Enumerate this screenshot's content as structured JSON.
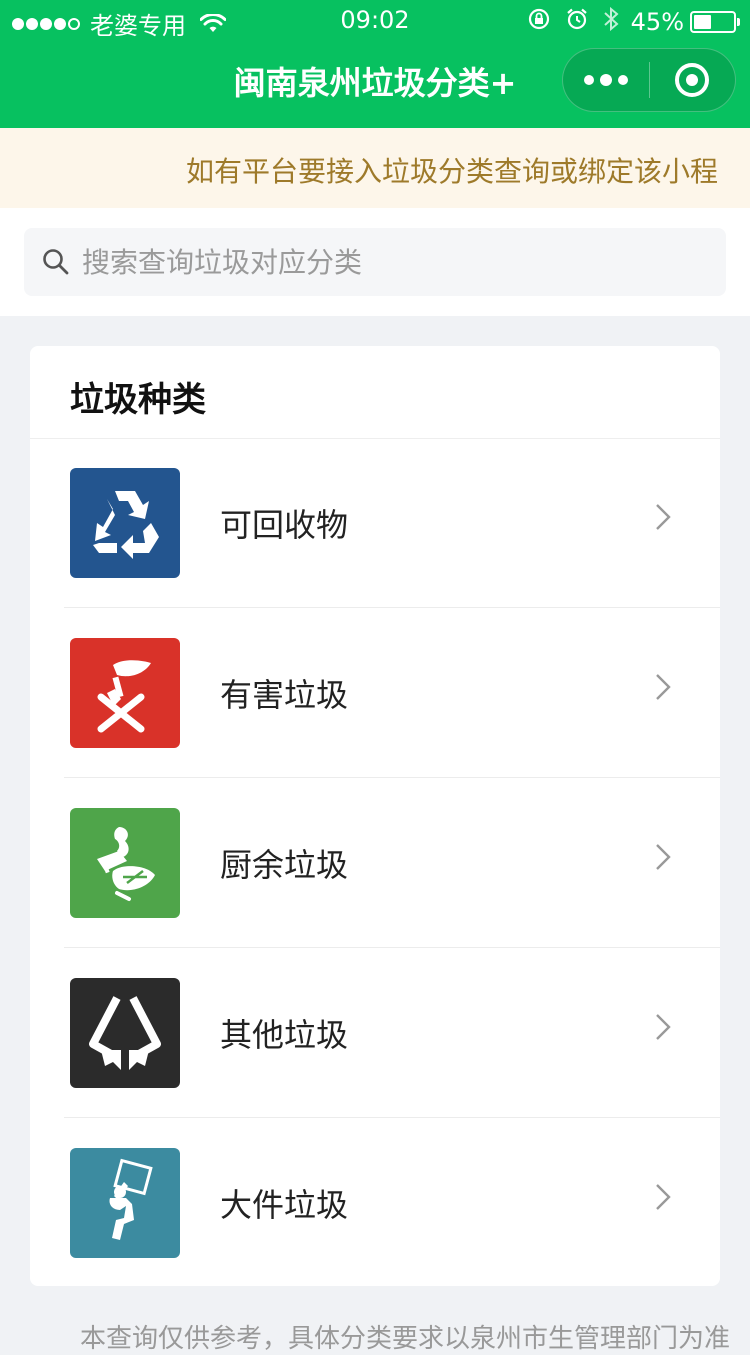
{
  "status_bar": {
    "carrier": "老婆专用",
    "time": "09:02",
    "battery_percent": "45%",
    "battery_level": 0.45
  },
  "nav": {
    "title": "闽南泉州垃圾分类+"
  },
  "notice": {
    "text": "如有平台要接入垃圾分类查询或绑定该小程"
  },
  "search": {
    "placeholder": "搜索查询垃圾对应分类",
    "value": ""
  },
  "categories_card": {
    "title": "垃圾种类",
    "items": [
      {
        "label": "可回收物",
        "icon": "recycle-icon",
        "color": "#23558f"
      },
      {
        "label": "有害垃圾",
        "icon": "hazardous-icon",
        "color": "#d93229"
      },
      {
        "label": "厨余垃圾",
        "icon": "kitchen-waste-icon",
        "color": "#4fa54a"
      },
      {
        "label": "其他垃圾",
        "icon": "other-waste-icon",
        "color": "#2b2b2b"
      },
      {
        "label": "大件垃圾",
        "icon": "bulky-waste-icon",
        "color": "#3c8ba0"
      }
    ]
  },
  "footer": {
    "text": "本查询仅供参考，具体分类要求以泉州市生管理部门为准"
  },
  "colors": {
    "brand_green": "#07c160",
    "notice_bg": "#fdf6ea",
    "notice_text": "#9e7a2a"
  }
}
